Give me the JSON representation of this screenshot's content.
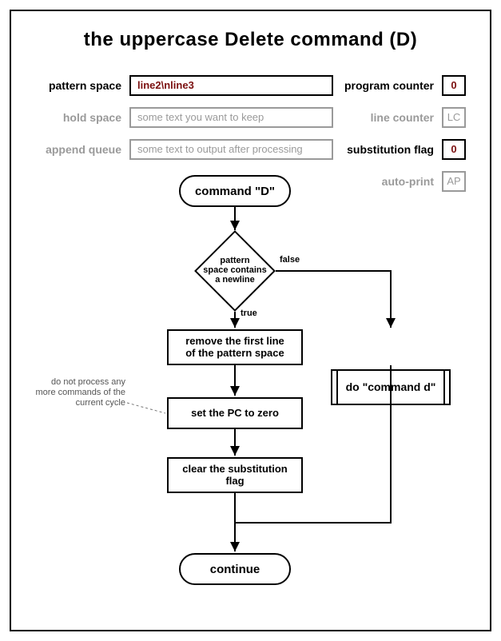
{
  "title": "the uppercase Delete command (D)",
  "registers": {
    "pattern_space": {
      "label": "pattern space",
      "value": "line2\\nline3"
    },
    "hold_space": {
      "label": "hold space",
      "value": "some text you want to keep"
    },
    "append_queue": {
      "label": "append queue",
      "value": "some text to output after processing"
    },
    "program_counter": {
      "label": "program counter",
      "value": "0"
    },
    "line_counter": {
      "label": "line counter",
      "value": "LC"
    },
    "sub_flag": {
      "label": "substitution flag",
      "value": "0"
    },
    "auto_print": {
      "label": "auto-print",
      "value": "AP"
    }
  },
  "flow": {
    "start": "command \"D\"",
    "decision": "pattern\nspace contains\na newline",
    "true_label": "true",
    "false_label": "false",
    "remove": "remove the first line\nof the pattern space",
    "set_pc": "set the PC to zero",
    "clear": "clear the substitution\nflag",
    "do_d": "do \"command d\"",
    "cont": "continue",
    "annot": "do not process any\nmore commands of the\ncurrent cycle"
  }
}
